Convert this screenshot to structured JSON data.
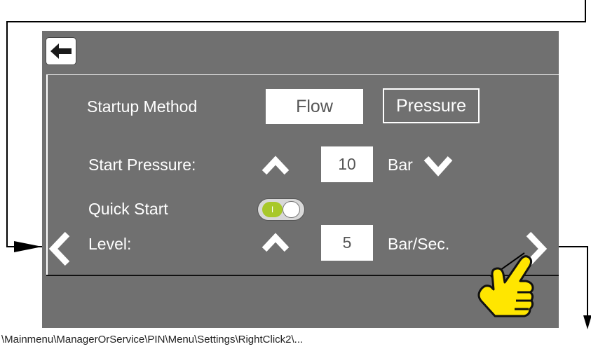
{
  "header": {
    "back_icon": "back-arrow-icon"
  },
  "startup": {
    "label": "Startup Method",
    "options": [
      "Flow",
      "Pressure"
    ],
    "selected": "Pressure"
  },
  "start_pressure": {
    "label": "Start Pressure:",
    "value": "10",
    "unit": "Bar"
  },
  "quick_start": {
    "label": "Quick Start",
    "enabled": true,
    "toggle_mark": "I",
    "level_label": "Level:",
    "level_value": "5",
    "level_unit": "Bar/Sec."
  },
  "nav": {
    "prev_icon": "chevron-left-icon",
    "next_icon": "chevron-right-icon"
  },
  "overlay": {
    "pointer_icon": "hand-pointer-icon"
  },
  "breadcrumb": "\\Mainmenu\\ManagerOrService\\PIN\\Menu\\Settings\\RightClick2\\...",
  "colors": {
    "screen_bg": "#707070",
    "toggle_on": "#a8c82a",
    "hand_yellow": "#ffe600"
  }
}
